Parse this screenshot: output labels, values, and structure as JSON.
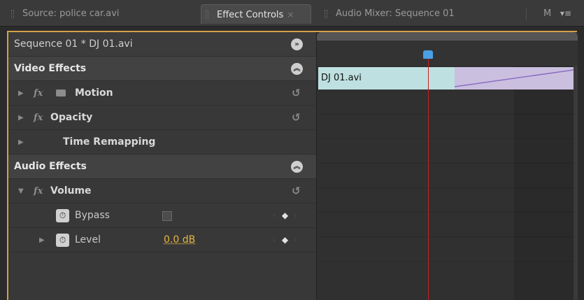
{
  "tabs": [
    {
      "label": "Source: police car.avi",
      "active": false
    },
    {
      "label": "Effect Controls",
      "active": true,
      "close": "×"
    },
    {
      "label": "Audio Mixer: Sequence 01",
      "active": false
    },
    {
      "label": "M",
      "active": false
    }
  ],
  "panel_menu_icon": "panel-menu-icon",
  "sequence_label": "Sequence 01 * DJ 01.avi",
  "video_effects": {
    "header": "Video Effects",
    "items": [
      {
        "label": "Motion",
        "fx": "fx"
      },
      {
        "label": "Opacity",
        "fx": "fx"
      },
      {
        "label": "Time Remapping"
      }
    ]
  },
  "audio_effects": {
    "header": "Audio Effects",
    "items": [
      {
        "label": "Volume",
        "fx": "fx"
      }
    ],
    "params": [
      {
        "label": "Bypass"
      },
      {
        "label": "Level",
        "value": "0.0 dB"
      }
    ]
  },
  "timeline": {
    "clip_label": "DJ 01.avi"
  },
  "colors": {
    "accent_frame": "#d4a04a",
    "clip_teal": "#bfe0e0",
    "clip_lavender": "#cbbfe0",
    "playhead": "#c82020",
    "playhead_head": "#4aa0e6",
    "value_yellow": "#e8b83e"
  }
}
